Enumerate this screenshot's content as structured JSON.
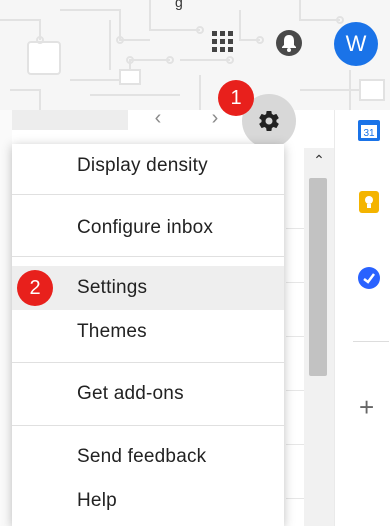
{
  "header": {
    "title_fragment": "g",
    "avatar_letter": "W",
    "icons": {
      "apps": "apps-grid-icon",
      "notifications": "bell-icon"
    }
  },
  "toolbar": {
    "prev": "‹",
    "next": "›",
    "settings_icon": "gear-icon"
  },
  "annotations": {
    "step1": "1",
    "step2": "2"
  },
  "menu": {
    "items": [
      {
        "label": "Display density"
      },
      {
        "label": "Configure inbox"
      },
      {
        "label": "Settings",
        "active": true
      },
      {
        "label": "Themes"
      },
      {
        "label": "Get add-ons"
      },
      {
        "label": "Send feedback"
      },
      {
        "label": "Help"
      }
    ]
  },
  "right_rail": {
    "calendar_day": "31",
    "icons": [
      "calendar-icon",
      "keep-icon",
      "tasks-icon",
      "add-icon"
    ],
    "plus": "+"
  },
  "scroll": {
    "up": "⌃"
  },
  "colors": {
    "accent": "#1a73e8",
    "badge": "#e8201c",
    "keep": "#f4b400"
  }
}
